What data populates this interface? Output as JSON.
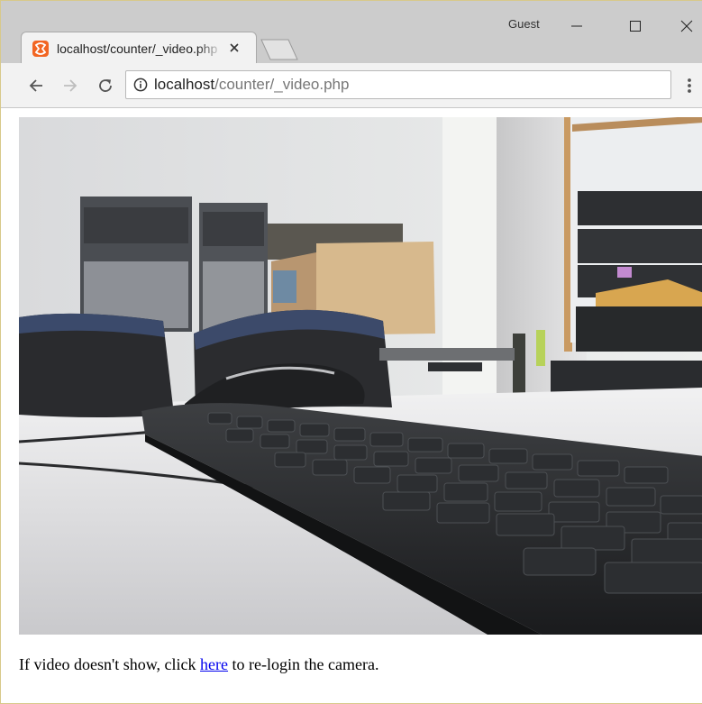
{
  "window": {
    "profile_label": "Guest"
  },
  "tab": {
    "title": "localhost/counter/_video.php",
    "favicon": "xampp-icon",
    "favicon_color": "#f26522"
  },
  "address_bar": {
    "url_host": "localhost",
    "url_path": "/counter/_video.php"
  },
  "page": {
    "video_feed": "camera-feed-image",
    "caption_before": "If video doesn't show, click ",
    "caption_link": "here",
    "caption_after": " to re-login the camera."
  },
  "colors": {
    "link": "#0000ee",
    "tab_strip": "#cccccc",
    "toolbar": "#f2f2f2"
  }
}
